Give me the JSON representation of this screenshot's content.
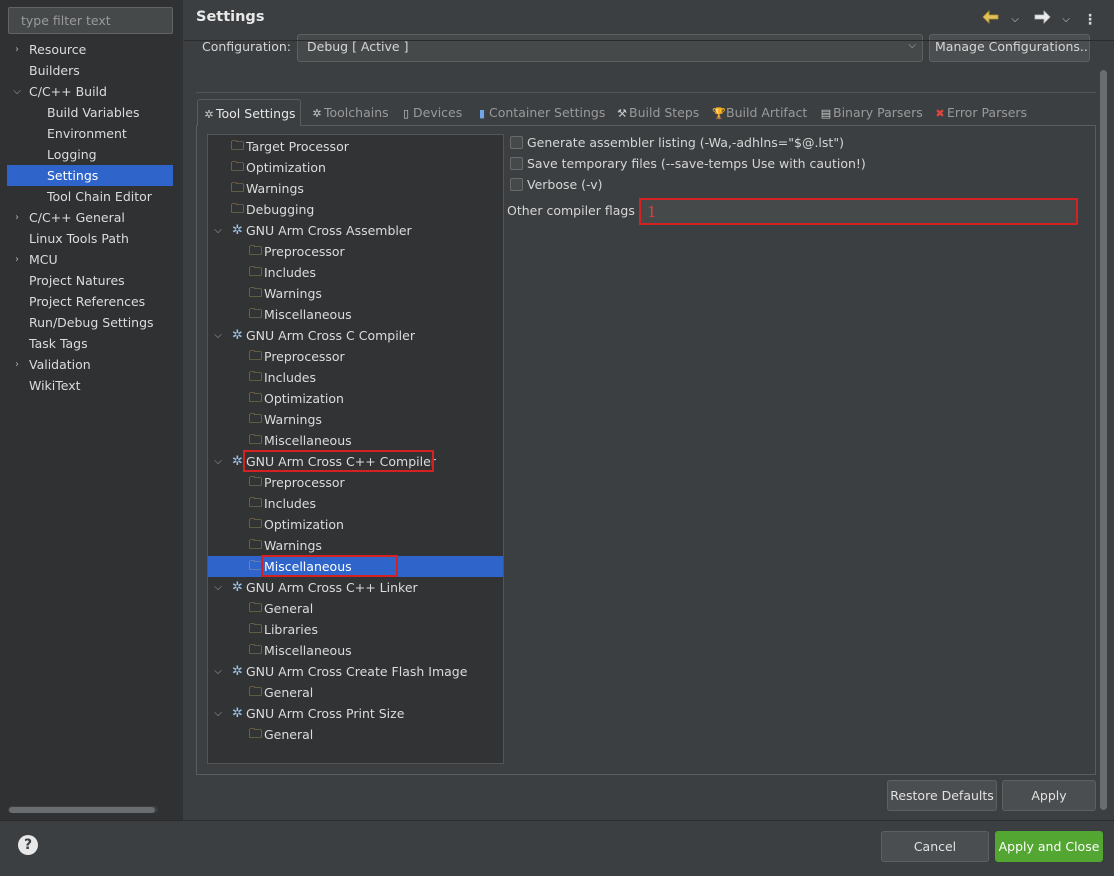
{
  "filter": {
    "placeholder": "type filter text"
  },
  "nav": {
    "items": [
      {
        "label": "Resource",
        "arrow": "›",
        "indent": 0
      },
      {
        "label": "Builders",
        "arrow": "",
        "indent": 0
      },
      {
        "label": "C/C++ Build",
        "arrow": "⌄",
        "indent": 0
      },
      {
        "label": "Build Variables",
        "arrow": "",
        "indent": 1
      },
      {
        "label": "Environment",
        "arrow": "",
        "indent": 1
      },
      {
        "label": "Logging",
        "arrow": "",
        "indent": 1
      },
      {
        "label": "Settings",
        "arrow": "",
        "indent": 1,
        "selected": true
      },
      {
        "label": "Tool Chain Editor",
        "arrow": "",
        "indent": 1
      },
      {
        "label": "C/C++ General",
        "arrow": "›",
        "indent": 0
      },
      {
        "label": "Linux Tools Path",
        "arrow": "",
        "indent": 0
      },
      {
        "label": "MCU",
        "arrow": "›",
        "indent": 0
      },
      {
        "label": "Project Natures",
        "arrow": "",
        "indent": 0
      },
      {
        "label": "Project References",
        "arrow": "",
        "indent": 0
      },
      {
        "label": "Run/Debug Settings",
        "arrow": "",
        "indent": 0
      },
      {
        "label": "Task Tags",
        "arrow": "",
        "indent": 0
      },
      {
        "label": "Validation",
        "arrow": "›",
        "indent": 0
      },
      {
        "label": "WikiText",
        "arrow": "",
        "indent": 0
      }
    ]
  },
  "header": {
    "title": "Settings",
    "icons": [
      "back-arrow-icon",
      "chevron-down-icon",
      "forward-arrow-icon",
      "chevron-down-icon",
      "more-vertical-icon"
    ]
  },
  "config": {
    "label": "Configuration:",
    "value": "Debug  [ Active ]",
    "manage_label": "Manage Configurations..."
  },
  "tabs": [
    {
      "label": "Tool Settings",
      "icon": "✲",
      "active": true
    },
    {
      "label": "Toolchains",
      "icon": "✲"
    },
    {
      "label": "Devices",
      "icon": "▯"
    },
    {
      "label": "Container Settings",
      "icon": "▮"
    },
    {
      "label": "Build Steps",
      "icon": "⚒"
    },
    {
      "label": "Build Artifact",
      "icon": "🏆"
    },
    {
      "label": "Binary Parsers",
      "icon": "▤"
    },
    {
      "label": "Error Parsers",
      "icon": "✖"
    }
  ],
  "tool_tree": [
    {
      "label": "Target Processor",
      "level": 0,
      "icon": "folder-gear-icon"
    },
    {
      "label": "Optimization",
      "level": 0,
      "icon": "folder-gear-icon"
    },
    {
      "label": "Warnings",
      "level": 0,
      "icon": "folder-gear-icon"
    },
    {
      "label": "Debugging",
      "level": 0,
      "icon": "folder-gear-icon"
    },
    {
      "label": "GNU Arm Cross Assembler",
      "level": 0,
      "icon": "gear-icon",
      "expanded": true
    },
    {
      "label": "Preprocessor",
      "level": 1,
      "icon": "folder-gear-icon"
    },
    {
      "label": "Includes",
      "level": 1,
      "icon": "folder-gear-icon"
    },
    {
      "label": "Warnings",
      "level": 1,
      "icon": "folder-gear-icon"
    },
    {
      "label": "Miscellaneous",
      "level": 1,
      "icon": "folder-gear-icon"
    },
    {
      "label": "GNU Arm Cross C Compiler",
      "level": 0,
      "icon": "gear-icon",
      "expanded": true
    },
    {
      "label": "Preprocessor",
      "level": 1,
      "icon": "folder-gear-icon"
    },
    {
      "label": "Includes",
      "level": 1,
      "icon": "folder-gear-icon"
    },
    {
      "label": "Optimization",
      "level": 1,
      "icon": "folder-gear-icon"
    },
    {
      "label": "Warnings",
      "level": 1,
      "icon": "folder-gear-icon"
    },
    {
      "label": "Miscellaneous",
      "level": 1,
      "icon": "folder-gear-icon"
    },
    {
      "label": "GNU Arm Cross C++ Compiler",
      "level": 0,
      "icon": "gear-icon",
      "expanded": true,
      "highlight": true
    },
    {
      "label": "Preprocessor",
      "level": 1,
      "icon": "folder-gear-icon"
    },
    {
      "label": "Includes",
      "level": 1,
      "icon": "folder-gear-icon"
    },
    {
      "label": "Optimization",
      "level": 1,
      "icon": "folder-gear-icon"
    },
    {
      "label": "Warnings",
      "level": 1,
      "icon": "folder-gear-icon"
    },
    {
      "label": "Miscellaneous",
      "level": 1,
      "icon": "folder-gear-icon",
      "selected": true,
      "highlight": true
    },
    {
      "label": "GNU Arm Cross C++ Linker",
      "level": 0,
      "icon": "gear-icon",
      "expanded": true
    },
    {
      "label": "General",
      "level": 1,
      "icon": "folder-gear-icon"
    },
    {
      "label": "Libraries",
      "level": 1,
      "icon": "folder-gear-icon"
    },
    {
      "label": "Miscellaneous",
      "level": 1,
      "icon": "folder-gear-icon"
    },
    {
      "label": "GNU Arm Cross Create Flash Image",
      "level": 0,
      "icon": "gear-icon",
      "expanded": true
    },
    {
      "label": "General",
      "level": 1,
      "icon": "folder-gear-icon"
    },
    {
      "label": "GNU Arm Cross Print Size",
      "level": 0,
      "icon": "gear-icon",
      "expanded": true
    },
    {
      "label": "General",
      "level": 1,
      "icon": "folder-gear-icon"
    }
  ],
  "options": {
    "assembler_listing": "Generate assembler listing (-Wa,-adhlns=\"$@.lst\")",
    "save_temps": "Save temporary files (--save-temps Use with caution!)",
    "verbose": "Verbose (-v)",
    "other_flags_label": "Other compiler flags",
    "other_flags_value": "1"
  },
  "buttons": {
    "restore": "Restore Defaults",
    "apply": "Apply",
    "cancel": "Cancel",
    "apply_close": "Apply and Close"
  },
  "colors": {
    "selection": "#2f65ca",
    "highlight_box": "#d42222",
    "primary_button": "#52a631"
  }
}
